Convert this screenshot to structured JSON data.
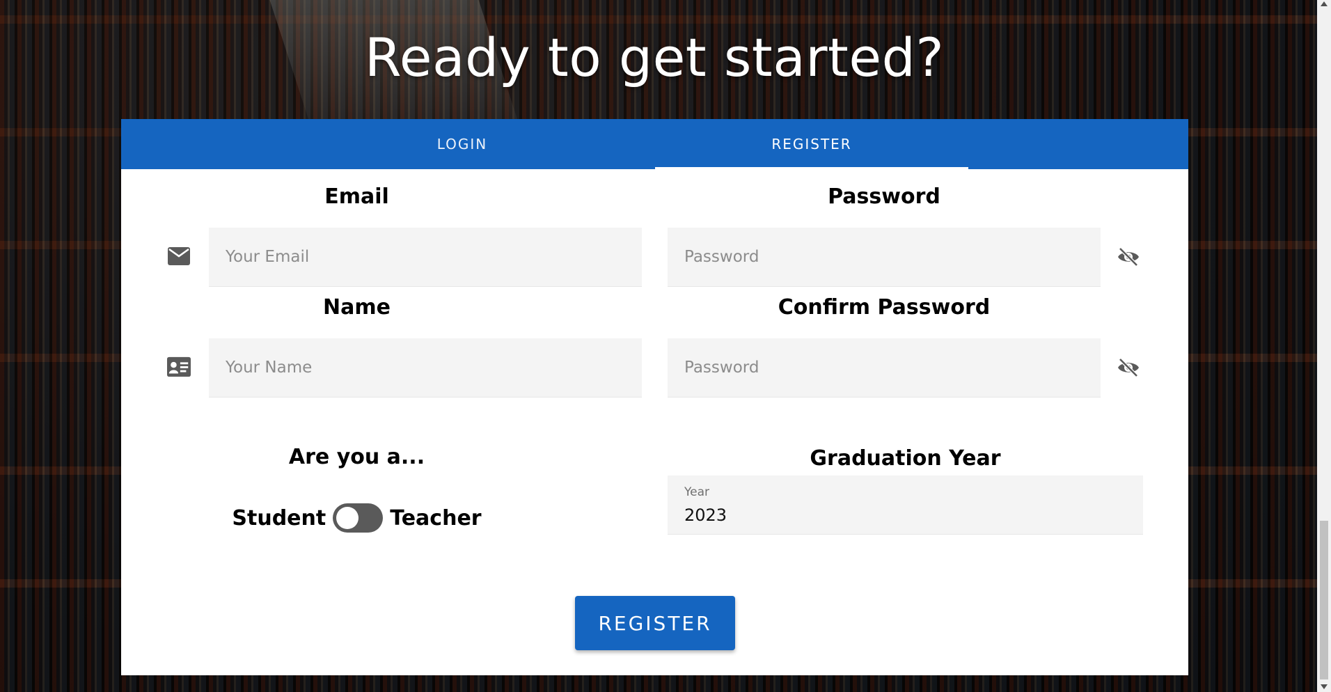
{
  "headline": "Ready to get started?",
  "tabs": [
    {
      "label": "LOGIN",
      "active": false
    },
    {
      "label": "REGISTER",
      "active": true
    }
  ],
  "form": {
    "email": {
      "label": "Email",
      "placeholder": "Your Email",
      "icon": "mail-icon"
    },
    "password": {
      "label": "Password",
      "placeholder": "Password",
      "icon": "visibility-off-icon"
    },
    "name": {
      "label": "Name",
      "placeholder": "Your Name",
      "icon": "id-card-icon"
    },
    "confirm_password": {
      "label": "Confirm Password",
      "placeholder": "Password",
      "icon": "visibility-off-icon"
    },
    "role": {
      "question": "Are you a...",
      "left_option": "Student",
      "right_option": "Teacher",
      "selected": "Student"
    },
    "graduation": {
      "label": "Graduation Year",
      "caption": "Year",
      "value": "2023"
    },
    "submit_label": "REGISTER"
  },
  "colors": {
    "primary": "#1565c0",
    "input_bg": "#f4f4f4",
    "toggle_track": "#5a5a5a"
  }
}
